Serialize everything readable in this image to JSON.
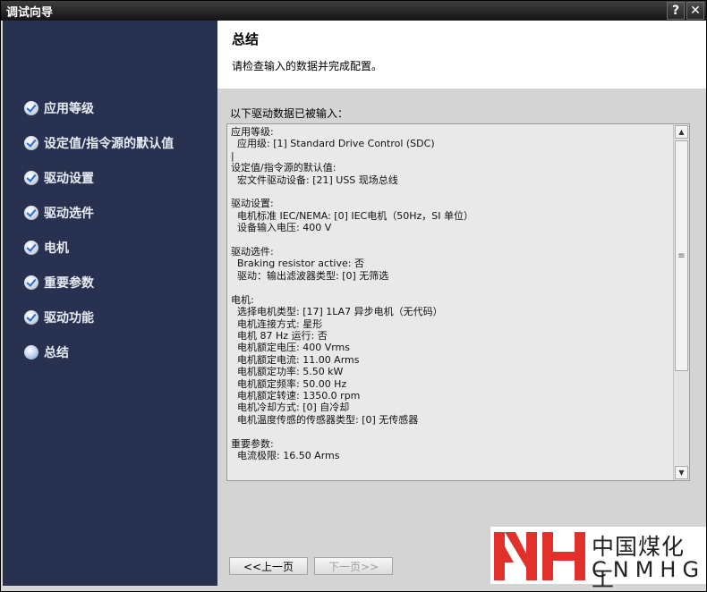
{
  "window": {
    "title": "调试向导",
    "help_label": "?",
    "close_label": "✕"
  },
  "sidebar": {
    "items": [
      {
        "label": "应用等级",
        "state": "done"
      },
      {
        "label": "设定值/指令源的默认值",
        "state": "done"
      },
      {
        "label": "驱动设置",
        "state": "done"
      },
      {
        "label": "驱动选件",
        "state": "done"
      },
      {
        "label": "电机",
        "state": "done"
      },
      {
        "label": "重要参数",
        "state": "done"
      },
      {
        "label": "驱动功能",
        "state": "done"
      },
      {
        "label": "总结",
        "state": "current"
      }
    ]
  },
  "header": {
    "title": "总结",
    "subtitle": "请检查输入的数据并完成配置。"
  },
  "main": {
    "intro": "以下驱动数据已被输入：",
    "summary_lines": [
      "应用等级:",
      "  应用级: [1] Standard Drive Control (SDC)",
      "|",
      "设定值/指令源的默认值:",
      "  宏文件驱动设备: [21] USS 现场总线",
      "",
      "驱动设置:",
      "  电机标准 IEC/NEMA: [0] IEC电机（50Hz，SI 单位）",
      "  设备输入电压: 400 V",
      "",
      "驱动选件:",
      "  Braking resistor active: 否",
      "  驱动：输出滤波器类型: [0] 无筛选",
      "",
      "电机:",
      "  选择电机类型: [17] 1LA7 异步电机（无代码）",
      "  电机连接方式: 星形",
      "  电机 87 Hz 运行: 否",
      "  电机额定电压: 400 Vrms",
      "  电机额定电流: 11.00 Arms",
      "  电机额定功率: 5.50 kW",
      "  电机额定频率: 50.00 Hz",
      "  电机额定转速: 1350.0 rpm",
      "  电机冷却方式: [0] 自冷却",
      "  电机温度传感的传感器类型: [0] 无传感器",
      "",
      "重要参数:",
      "  电流极限: 16.50 Arms"
    ],
    "scroll_grip": "≡",
    "prev_label": "<<上一页",
    "next_label": "下一页>>"
  },
  "watermark": {
    "chinese": "中国煤化工",
    "latin": "CNMHG",
    "color": "#e0312b"
  }
}
